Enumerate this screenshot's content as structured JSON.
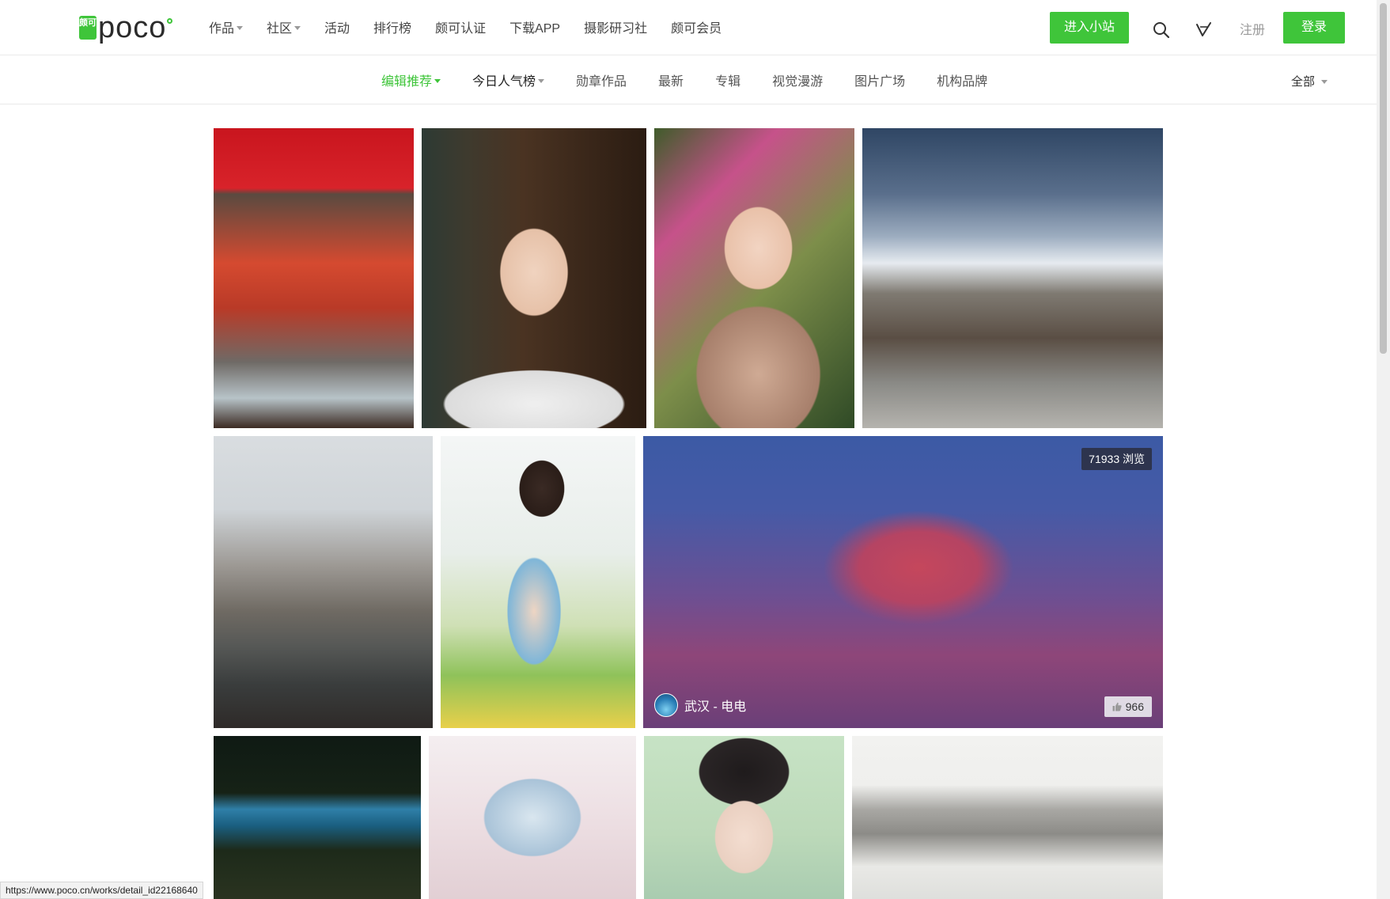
{
  "brand": {
    "logo_badge": "颇可",
    "logo_text": "poco",
    "accent": "#3fc53a"
  },
  "main_nav": [
    {
      "label": "作品",
      "dropdown": true
    },
    {
      "label": "社区",
      "dropdown": true
    },
    {
      "label": "活动",
      "dropdown": false
    },
    {
      "label": "排行榜",
      "dropdown": false
    },
    {
      "label": "颇可认证",
      "dropdown": false
    },
    {
      "label": "下载APP",
      "dropdown": false
    },
    {
      "label": "摄影研习社",
      "dropdown": false
    },
    {
      "label": "颇可会员",
      "dropdown": false
    }
  ],
  "header_actions": {
    "enter_site": "进入小站",
    "register": "注册",
    "login": "登录"
  },
  "sub_nav": {
    "tabs": [
      {
        "label": "编辑推荐",
        "active": true,
        "dropdown": true
      },
      {
        "label": "今日人气榜",
        "active": false,
        "dropdown": true
      },
      {
        "label": "勋章作品",
        "active": false,
        "dropdown": false
      },
      {
        "label": "最新",
        "active": false,
        "dropdown": false
      },
      {
        "label": "专辑",
        "active": false,
        "dropdown": false
      },
      {
        "label": "视觉漫游",
        "active": false,
        "dropdown": false
      },
      {
        "label": "图片广场",
        "active": false,
        "dropdown": false
      },
      {
        "label": "机构品牌",
        "active": false,
        "dropdown": false
      }
    ],
    "filter": "全部"
  },
  "featured": {
    "views": "71933 浏览",
    "author": "武汉 - 电电",
    "likes": "966"
  },
  "status_url": "https://www.poco.cn/works/detail_id22168640"
}
